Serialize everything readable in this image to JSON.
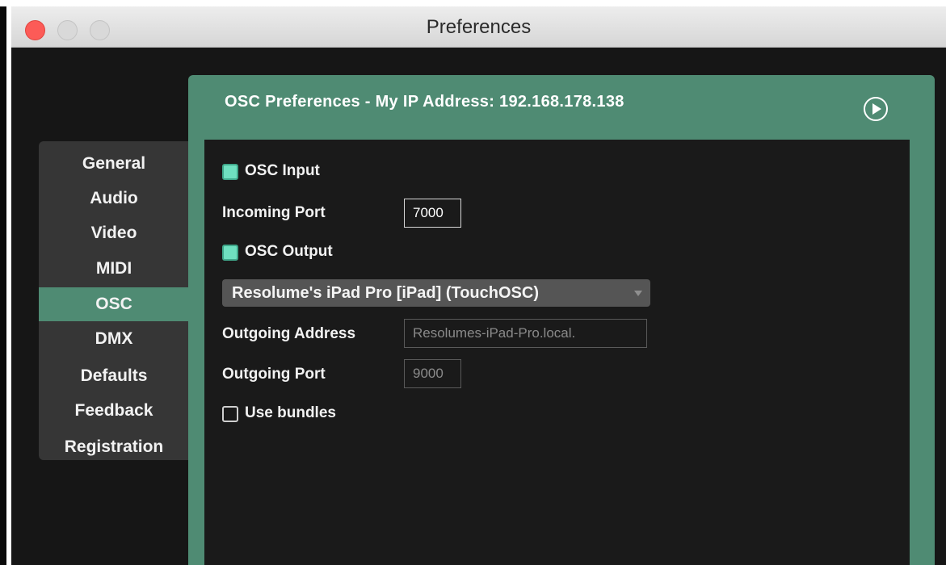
{
  "window": {
    "title": "Preferences"
  },
  "sidebar": {
    "items": [
      {
        "label": "General"
      },
      {
        "label": "Audio"
      },
      {
        "label": "Video"
      },
      {
        "label": "MIDI"
      },
      {
        "label": "OSC",
        "active": true
      },
      {
        "label": "DMX"
      },
      {
        "label": "Defaults"
      },
      {
        "label": "Feedback"
      },
      {
        "label": "Registration"
      }
    ]
  },
  "panel": {
    "title": "OSC Preferences - My IP Address: 192.168.178.138",
    "osc_input": {
      "label": "OSC Input",
      "checked": true
    },
    "incoming_port": {
      "label": "Incoming Port",
      "value": "7000"
    },
    "osc_output": {
      "label": "OSC Output",
      "checked": true
    },
    "output_device": {
      "selected": "Resolume's iPad Pro [iPad] (TouchOSC)"
    },
    "outgoing_address": {
      "label": "Outgoing Address",
      "value": "Resolumes-iPad-Pro.local."
    },
    "outgoing_port": {
      "label": "Outgoing Port",
      "value": "9000"
    },
    "use_bundles": {
      "label": "Use bundles",
      "checked": false
    }
  },
  "colors": {
    "accent": "#4f8b73",
    "checkbox_on": "#6fe0c0",
    "background": "#161616"
  }
}
